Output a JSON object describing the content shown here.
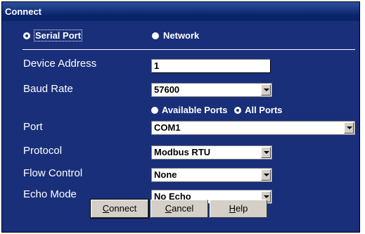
{
  "window": {
    "title": "Connect"
  },
  "mode": {
    "serial_label": "Serial Port",
    "network_label": "Network",
    "selected": "serial"
  },
  "fields": {
    "device_address": {
      "label": "Device Address",
      "value": "1"
    },
    "baud_rate": {
      "label": "Baud Rate",
      "value": "57600"
    },
    "ports_filter": {
      "available_label": "Available Ports",
      "all_label": "All Ports",
      "selected": "all"
    },
    "port": {
      "label": "Port",
      "value": "COM1"
    },
    "protocol": {
      "label": "Protocol",
      "value": "Modbus RTU"
    },
    "flow_control": {
      "label": "Flow Control",
      "value": "None"
    },
    "echo_mode": {
      "label": "Echo Mode",
      "value": "No Echo"
    }
  },
  "buttons": {
    "connect": {
      "label_pre": "",
      "label_accel": "C",
      "label_post": "onnect"
    },
    "cancel": {
      "label_pre": "",
      "label_accel": "C",
      "label_post": "ancel"
    },
    "help": {
      "label_pre": "",
      "label_accel": "H",
      "label_post": "elp"
    }
  },
  "colors": {
    "frame": "#0a246a",
    "body": "#1a2f7a",
    "button_face": "#d4d0c8"
  }
}
